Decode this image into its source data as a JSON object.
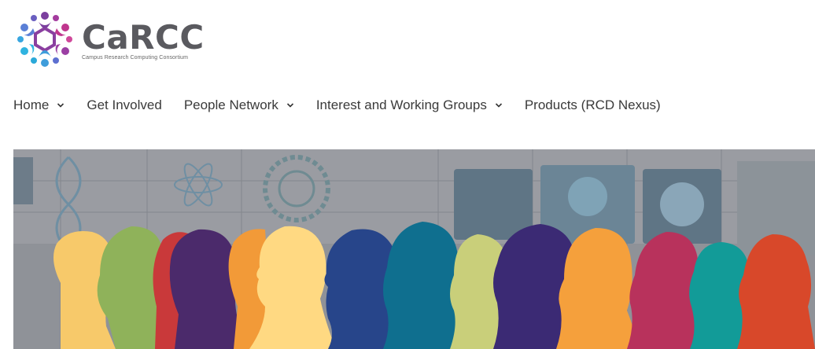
{
  "logo": {
    "title": "CaRCC",
    "subtitle": "Campus Research Computing Consortium",
    "icon": "people-ring-logo-icon"
  },
  "nav": {
    "items": [
      {
        "label": "Home",
        "has_dropdown": true
      },
      {
        "label": "Get Involved",
        "has_dropdown": false
      },
      {
        "label": "People Network",
        "has_dropdown": true
      },
      {
        "label": "Interest and Working Groups",
        "has_dropdown": true
      },
      {
        "label": "Products (RCD Nexus)",
        "has_dropdown": false
      }
    ],
    "dropdown_icon": "chevron-down-icon"
  },
  "hero": {
    "image": "diverse-people-silhouettes-banner",
    "colors": [
      "#f7c96a",
      "#8fb25a",
      "#c9393a",
      "#4b2a6b",
      "#f29a38",
      "#ffd982",
      "#27458a",
      "#0f6f8f",
      "#c9cf7a",
      "#3b2a74",
      "#f5a03c",
      "#b8325c",
      "#129b98",
      "#d8482a"
    ]
  }
}
